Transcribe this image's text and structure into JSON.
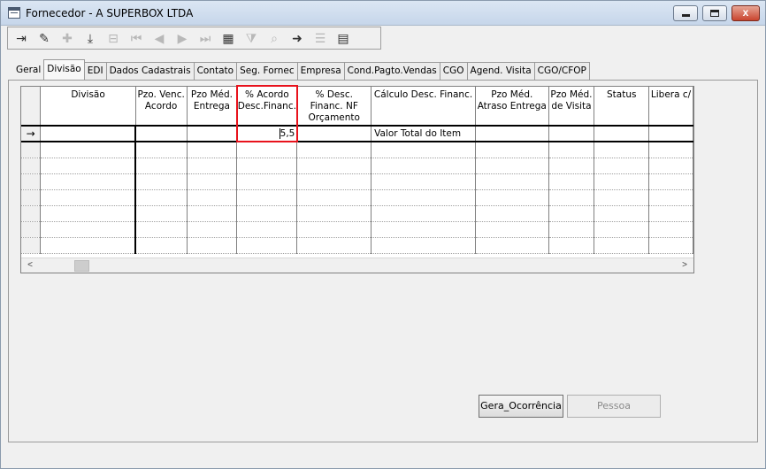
{
  "window": {
    "title": "Fornecedor - A SUPERBOX LTDA",
    "controls": {
      "minimize": "minimize",
      "maximize": "maximize",
      "close": "x"
    }
  },
  "toolbar": {
    "buttons": [
      {
        "name": "exit-icon",
        "glyph": "⇥",
        "enabled": true
      },
      {
        "name": "edit-icon",
        "glyph": "✎",
        "enabled": true
      },
      {
        "name": "new-record-icon",
        "glyph": "✚",
        "enabled": false
      },
      {
        "name": "save-icon",
        "glyph": "⤓",
        "enabled": true
      },
      {
        "name": "cancel-icon",
        "glyph": "⊟",
        "enabled": false
      },
      {
        "name": "first-record-icon",
        "glyph": "⏮",
        "enabled": false
      },
      {
        "name": "previous-record-icon",
        "glyph": "◀",
        "enabled": false
      },
      {
        "name": "next-record-icon",
        "glyph": "▶",
        "enabled": false
      },
      {
        "name": "last-record-icon",
        "glyph": "⏭",
        "enabled": false
      },
      {
        "name": "grid-icon",
        "glyph": "▦",
        "enabled": true
      },
      {
        "name": "filter-icon",
        "glyph": "⧩",
        "enabled": false
      },
      {
        "name": "search-icon",
        "glyph": "⌕",
        "enabled": false
      },
      {
        "name": "export-icon",
        "glyph": "➜",
        "enabled": true
      },
      {
        "name": "report-icon",
        "glyph": "☰",
        "enabled": false
      },
      {
        "name": "table-icon",
        "glyph": "▤",
        "enabled": true
      }
    ]
  },
  "tabs": [
    {
      "label": "Geral"
    },
    {
      "label": "Divisão",
      "active": true
    },
    {
      "label": "EDI"
    },
    {
      "label": "Dados Cadastrais"
    },
    {
      "label": "Contato"
    },
    {
      "label": "Seg. Fornec"
    },
    {
      "label": "Empresa"
    },
    {
      "label": "Cond.Pagto.Vendas"
    },
    {
      "label": "CGO"
    },
    {
      "label": "Agend. Visita"
    },
    {
      "label": "CGO/CFOP"
    }
  ],
  "grid": {
    "columns": [
      {
        "label": "Divisão"
      },
      {
        "label": "Pzo. Venc. Acordo"
      },
      {
        "label": "Pzo Méd. Entrega"
      },
      {
        "label": "% Acordo Desc.Financ."
      },
      {
        "label": "% Desc. Financ. NF Orçamento"
      },
      {
        "label": "Cálculo Desc. Financ."
      },
      {
        "label": "Pzo Méd. Atraso Entrega"
      },
      {
        "label": "Pzo Méd. de Visita"
      },
      {
        "label": "Status"
      },
      {
        "label": "Libera c/"
      }
    ],
    "current_row_indicator": "→",
    "rows": [
      {
        "divisao": "",
        "pzo_venc": "",
        "pzo_entrega": "",
        "acordo_desc": "5,5",
        "desc_nf": "",
        "calculo": "Valor Total do Item",
        "atraso": "",
        "visita": "",
        "status": "",
        "libera": ""
      }
    ],
    "scroll": {
      "left": "<",
      "right": ">"
    }
  },
  "buttons": {
    "gera_ocorrencia": "Gera_Ocorrência",
    "pessoa": "Pessoa"
  },
  "colors": {
    "highlight": "#e8121c",
    "window_bg": "#f0f0f0"
  }
}
